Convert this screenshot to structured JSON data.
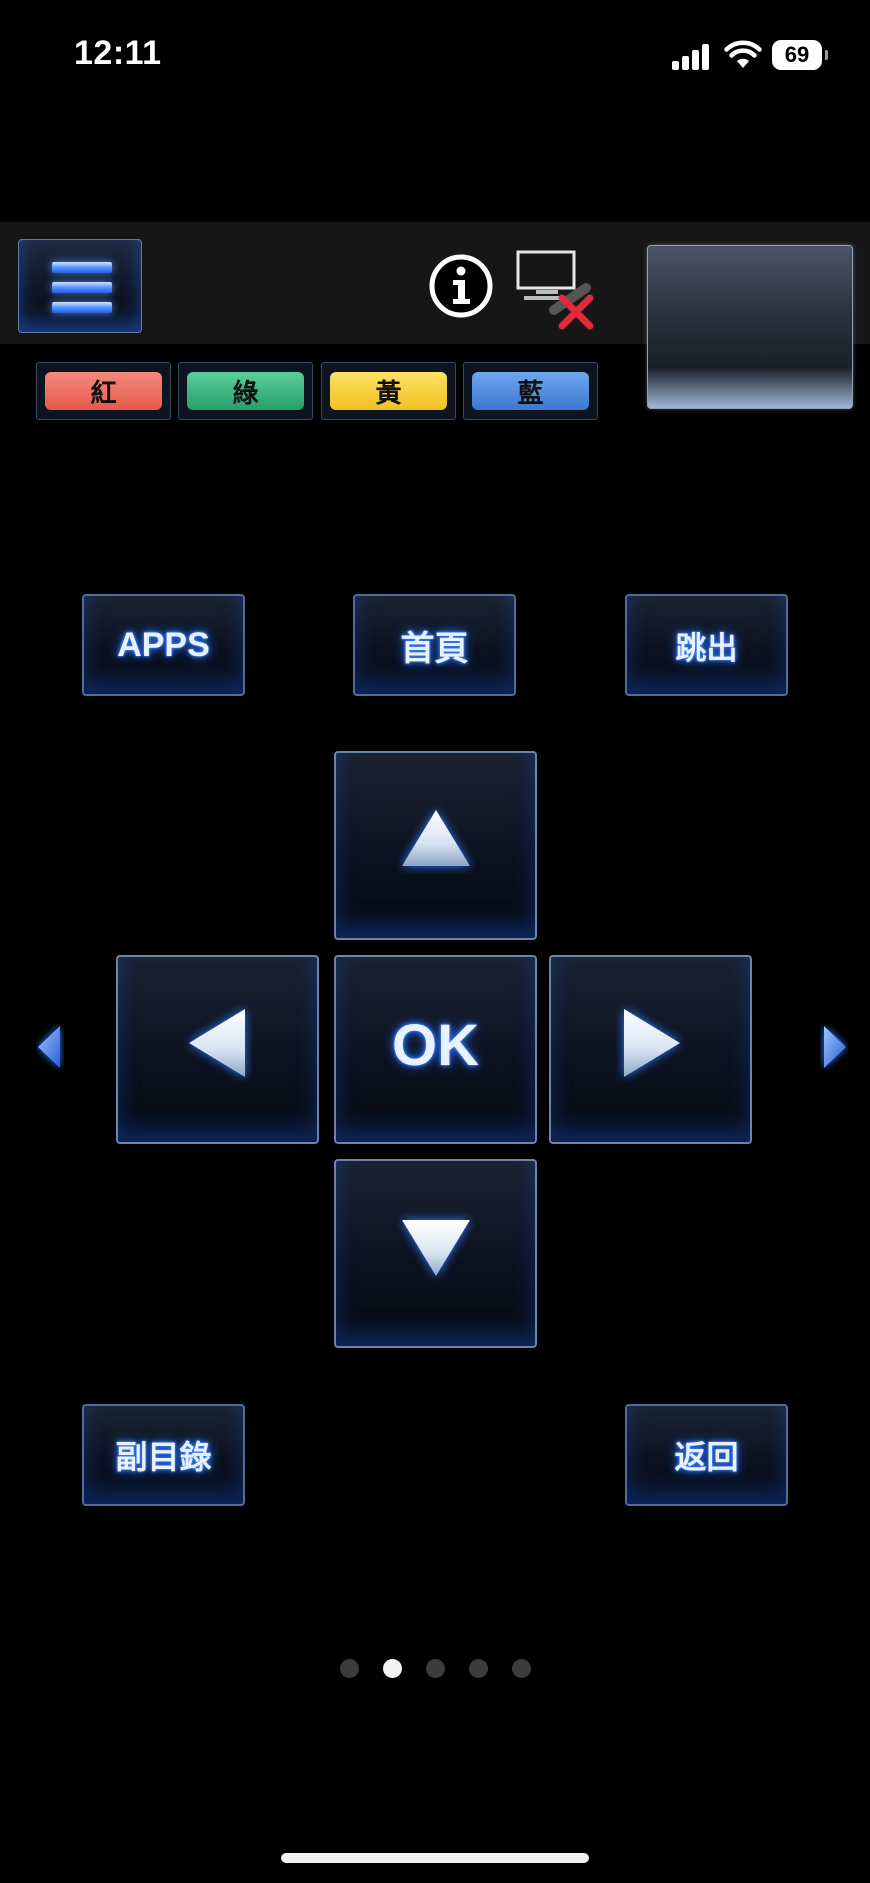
{
  "status_bar": {
    "time": "12:11",
    "battery_level": "69",
    "icons": [
      "signal-icon",
      "wifi-icon",
      "battery-icon"
    ]
  },
  "toolbar": {
    "menu_icon": "hamburger-menu-icon",
    "info_icon": "info-icon",
    "tv_status_icon": "tv-disconnected-icon"
  },
  "color_keys": [
    {
      "label": "紅",
      "color": "#e9675a"
    },
    {
      "label": "綠",
      "color": "#34b07a"
    },
    {
      "label": "黃",
      "color": "#f2cc33"
    },
    {
      "label": "藍",
      "color": "#4a86d6"
    }
  ],
  "top_buttons": {
    "apps": "APPS",
    "home": "首頁",
    "exit": "跳出"
  },
  "dpad": {
    "up_icon": "arrow-up-icon",
    "down_icon": "arrow-down-icon",
    "left_icon": "arrow-left-icon",
    "right_icon": "arrow-right-icon",
    "ok": "OK"
  },
  "bottom_buttons": {
    "submenu": "副目錄",
    "back": "返回"
  },
  "pager": {
    "total_pages": 5,
    "current_page": 2
  },
  "colors": {
    "background": "#000000",
    "toolbar_band": "#161616",
    "button_border": "#4e6d99",
    "glow": "#2f7bff"
  }
}
